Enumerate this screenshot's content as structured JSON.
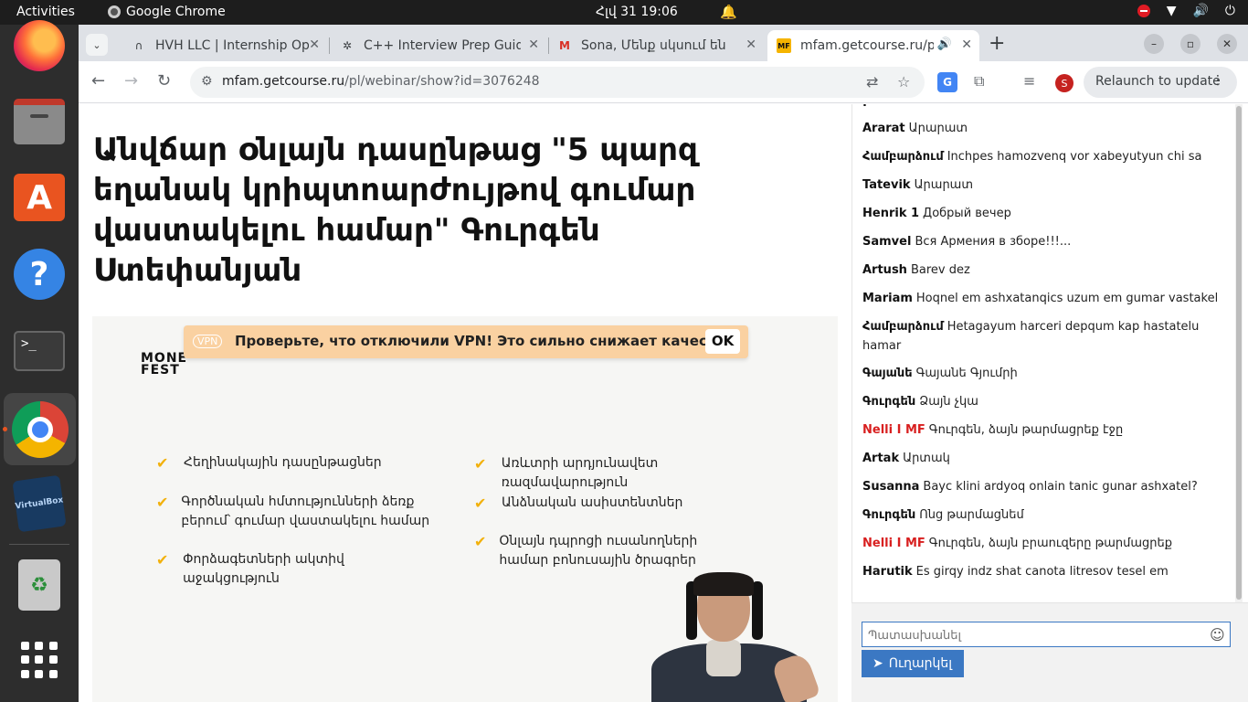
{
  "system": {
    "activities": "Activities",
    "app_name": "Google Chrome",
    "clock": "Հլվ 31  19:06"
  },
  "dock": {
    "items": [
      "firefox-icon",
      "files-icon",
      "app-center-icon",
      "help-icon",
      "terminal-icon",
      "chrome-icon",
      "virtualbox-icon",
      "trash-icon",
      "show-apps-icon"
    ],
    "virtualbox_label": "VirtualBox"
  },
  "browser": {
    "tabs": [
      {
        "title": "HVH LLC | Internship Opp",
        "icon": "hvh-favicon"
      },
      {
        "title": "C++ Interview Prep Guide",
        "icon": "openai-favicon"
      },
      {
        "title": "Sona, Մենք սկսում են",
        "icon": "gmail-favicon"
      },
      {
        "title": "mfam.getcourse.ru/pl",
        "icon": "mf-favicon",
        "active": true
      }
    ],
    "favicon_mf": "MF",
    "url_host": "mfam.getcourse.ru",
    "url_path": "/pl/webinar/show?id=3076248",
    "relaunch_label": "Relaunch to update",
    "profile_initial": "S"
  },
  "page": {
    "title": "Անվճար օնլայն դասընթաց \"5 պարզ եղանակ կրիպտոարժույթով գումար վաստակելու համար\" Գուրգեն Ստեփանյան",
    "video": {
      "brand_line1": "MONE",
      "brand_line2": "FEST",
      "features_left": [
        "Հեղինակային դասընթացներ",
        "Գործնական հմտությունների ձեռք բերում՝ գումար վաստակելու համար",
        "Փորձագետների ակտիվ աջակցություն"
      ],
      "features_right": [
        "Առևտրի արդյունավետ ռազմավարություն",
        "Անձնական ասիստենտներ",
        "Օնլայն դպրոցի ուսանողների համար բոնուսային ծրագրեր"
      ]
    },
    "vpn_banner": {
      "tag": "VPN",
      "text": "Проверьте, что отключили VPN! Это сильно снижает качество",
      "ok": "OK"
    }
  },
  "chat": {
    "messages": [
      {
        "author": "Ararat",
        "text": "Արարատ",
        "staff": false
      },
      {
        "author": "Համբարձում",
        "text": "Inchpes hamozvenq vor xabeyutyun chi sa",
        "staff": false
      },
      {
        "author": "Tatevik",
        "text": "Արարատ",
        "staff": false
      },
      {
        "author": "Henrik 1",
        "text": "Добрый вечер",
        "staff": false
      },
      {
        "author": "Samvel",
        "text": "Вся Армения в зборе!!!...",
        "staff": false
      },
      {
        "author": "Artush",
        "text": "Barev dez",
        "staff": false
      },
      {
        "author": "Mariam",
        "text": "Hoqnel em ashxatanqics uzum em gumar vastakel",
        "staff": false
      },
      {
        "author": "Համբարձում",
        "text": "Hetagayum harceri depqum kap hastatelu hamar",
        "staff": false
      },
      {
        "author": "Գայանե",
        "text": "Գայանե Գյումրի",
        "staff": false
      },
      {
        "author": "Գուրգեն",
        "text": "Ձայն չկա",
        "staff": false
      },
      {
        "author": "Nelli I MF",
        "text": "Գուրգեն, ձայն թարմացրեք էջը",
        "staff": true
      },
      {
        "author": "Artak",
        "text": "Արտակ",
        "staff": false
      },
      {
        "author": "Susanna",
        "text": "Bayc klini ardyoq onlain tanic gunar ashxatel?",
        "staff": false
      },
      {
        "author": "Գուրգեն",
        "text": "Ոնց թարմացնեմ",
        "staff": false
      },
      {
        "author": "Nelli I MF",
        "text": "Գուրգեն, ձայն բրաուզերը թարմացրեք",
        "staff": true
      },
      {
        "author": "Harutik",
        "text": "Es girqy indz shat canota litresov tesel em",
        "staff": false
      }
    ],
    "reply_placeholder": "Պատասխանել",
    "send_label": "Ուղարկել"
  }
}
